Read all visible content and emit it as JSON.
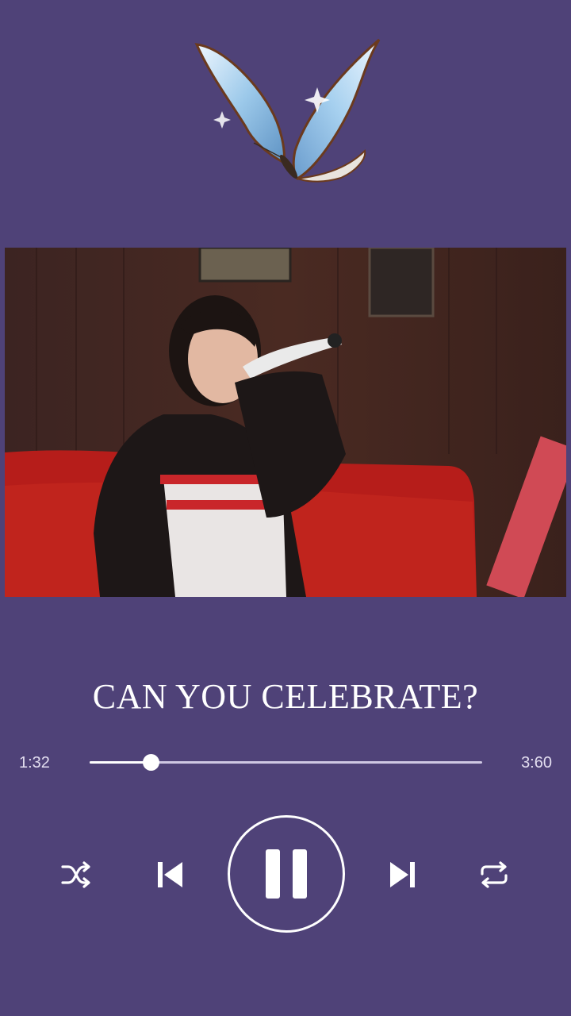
{
  "player": {
    "song_title": "CAN YOU CELEBRATE?",
    "elapsed_time": "1:32",
    "total_time": "3:60",
    "progress": 0.155,
    "state": "playing"
  },
  "controls": {
    "shuffle_icon": "shuffle-icon",
    "previous_icon": "skip-previous-icon",
    "pause_icon": "pause-icon",
    "next_icon": "skip-next-icon",
    "repeat_icon": "repeat-icon"
  },
  "colors": {
    "background": "#4f4278",
    "foreground": "#ffffff",
    "track": "#cfc7e3"
  }
}
